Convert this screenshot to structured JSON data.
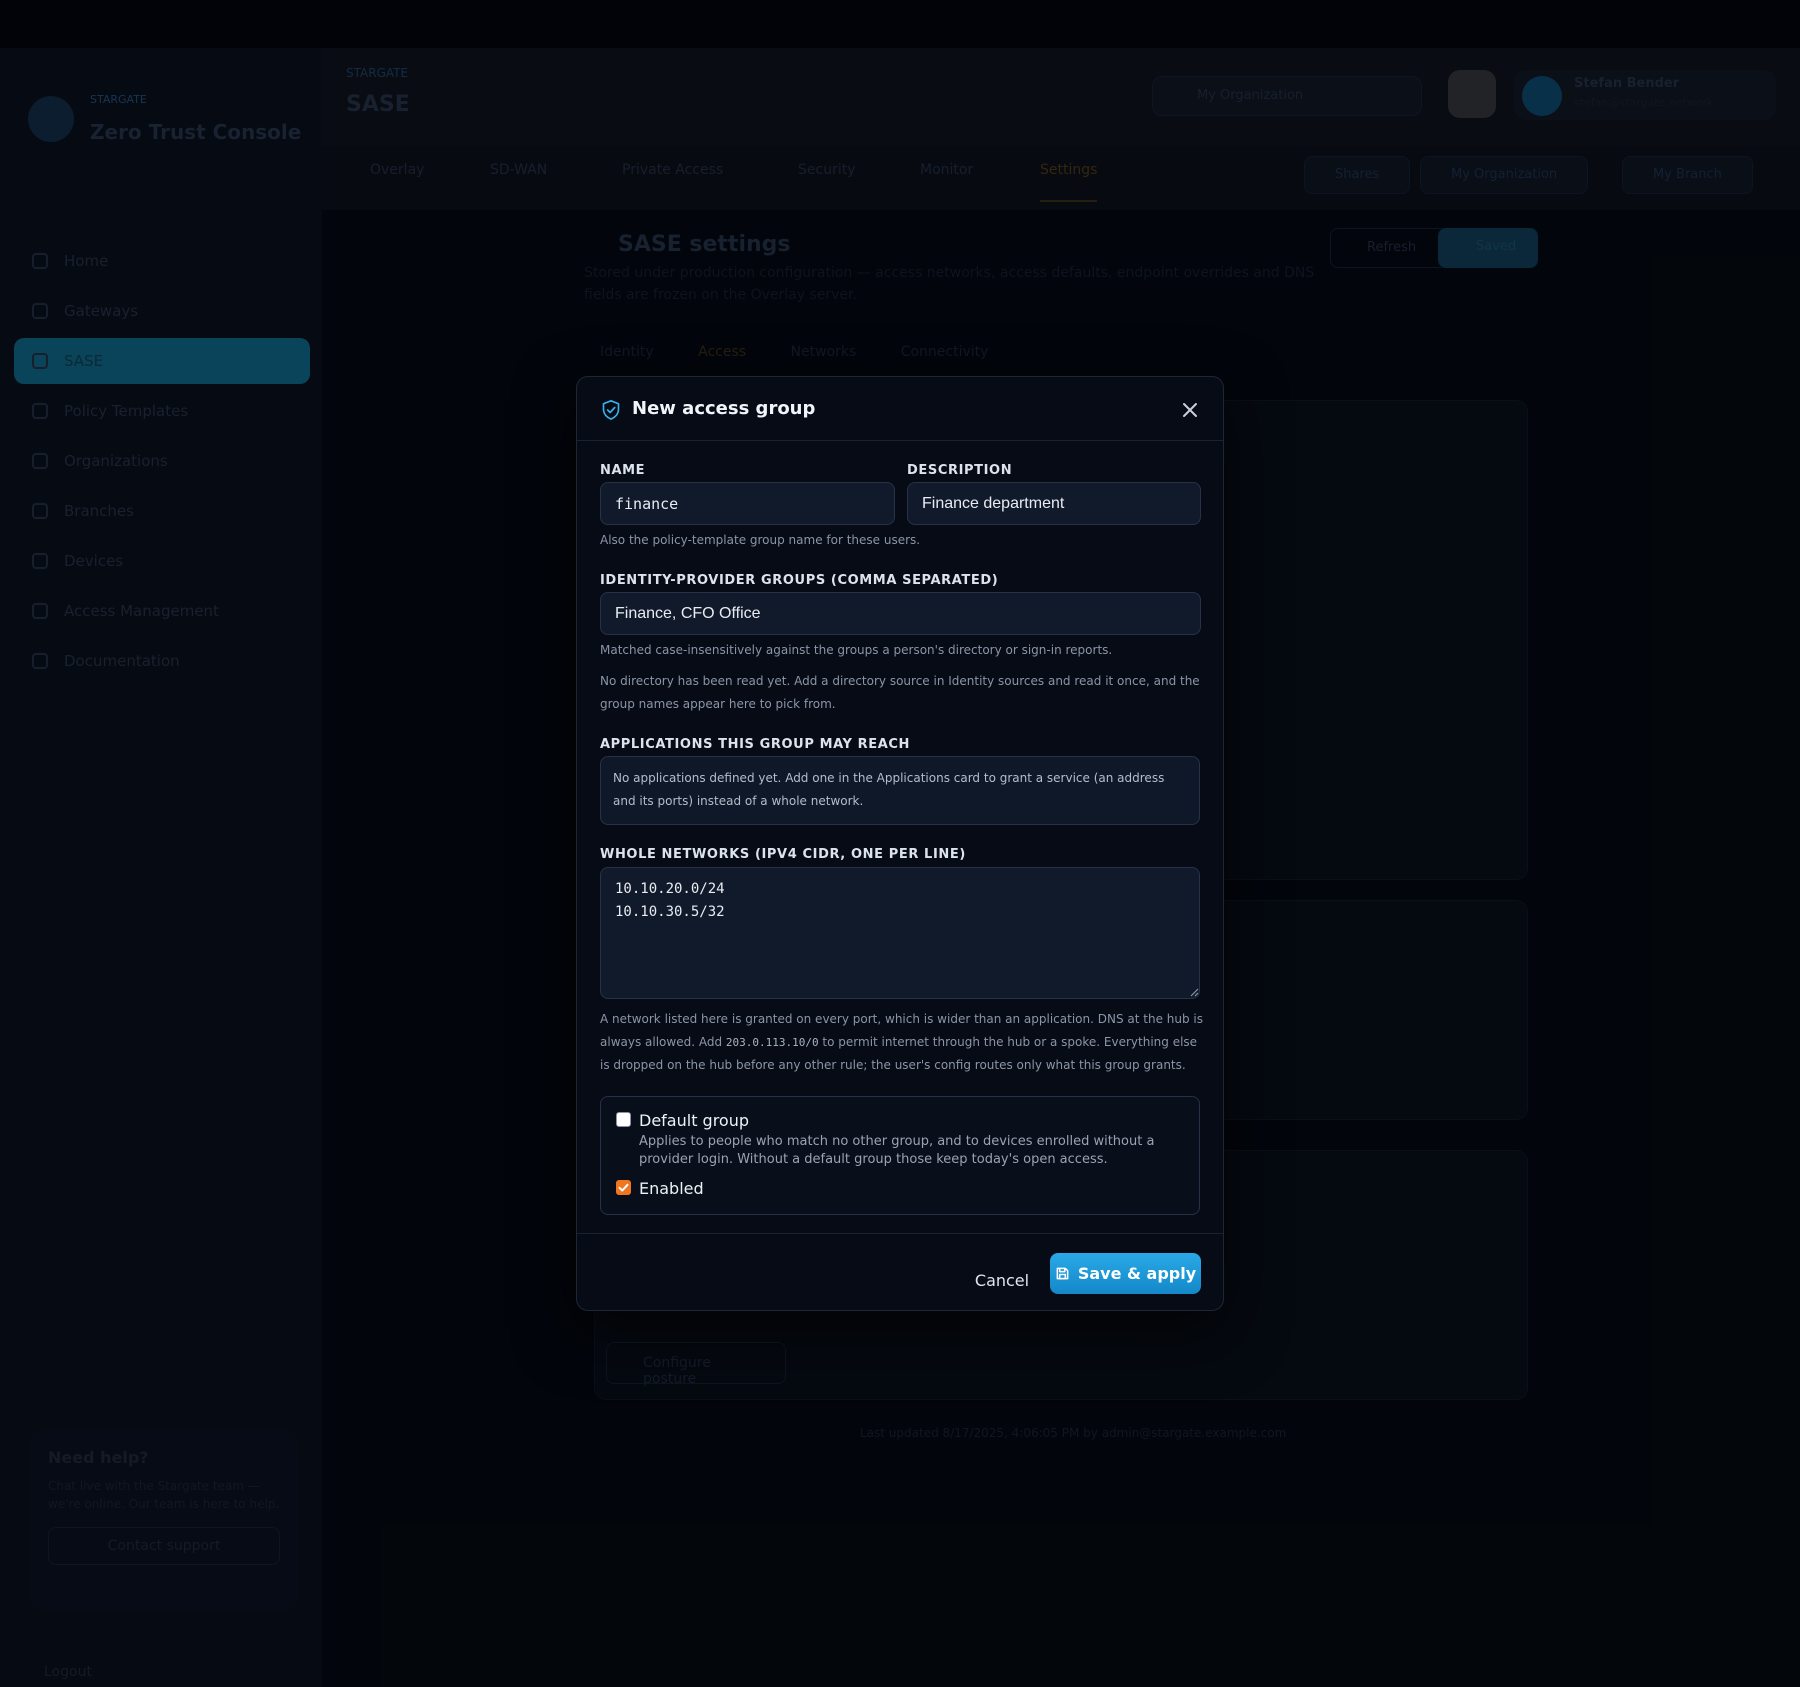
{
  "background": {
    "brand": {
      "kicker": "STARGATE",
      "name": "Zero Trust Console"
    },
    "nav": [
      "Home",
      "Gateways",
      "SASE",
      "Policy Templates",
      "Organizations",
      "Branches",
      "Devices",
      "Access Management",
      "Documentation"
    ],
    "help": {
      "title": "Need help?",
      "text": "Chat live with the Stargate team — we're online. Our team is here to help.",
      "button": "Contact support"
    },
    "logout": "Logout",
    "header": {
      "crumb": "STARGATE",
      "title": "SASE",
      "org": "My Organization",
      "user_name": "Stefan Bender",
      "user_email": "stefan@stargate.network"
    },
    "tabs": [
      "Overlay",
      "SD-WAN",
      "Private Access",
      "Security",
      "Monitor",
      "Settings"
    ],
    "right_pills": [
      "Shares",
      "My Organization",
      "My Branch"
    ],
    "content": {
      "title": "SASE settings",
      "subtitle": "Stored under production configuration — access networks, access defaults, endpoint overrides and DNS fields are frozen on the Overlay server.",
      "refresh": "Refresh",
      "save_all": "Saved",
      "subtabs": [
        "Identity",
        "Access",
        "Networks",
        "Connectivity"
      ],
      "configure_button": "Configure posture",
      "footnote": "Last updated 8/17/2025, 4:06:05 PM by admin@stargate.example.com"
    }
  },
  "modal": {
    "title": "New access group",
    "name": {
      "label": "NAME",
      "value": "finance",
      "help": "Also the policy-template group name for these users."
    },
    "description": {
      "label": "DESCRIPTION",
      "value": "Finance department"
    },
    "idp": {
      "label": "IDENTITY-PROVIDER GROUPS (COMMA SEPARATED)",
      "value": "Finance, CFO Office",
      "help1": "Matched case-insensitively against the groups a person's directory or sign-in reports.",
      "help2": "No directory has been read yet. Add a directory source in Identity sources and read it once, and the group names appear here to pick from."
    },
    "apps": {
      "label": "APPLICATIONS THIS GROUP MAY REACH",
      "empty": "No applications defined yet. Add one in the Applications card to grant a service (an address and its ports) instead of a whole network."
    },
    "networks": {
      "label": "WHOLE NETWORKS (IPV4 CIDR, ONE PER LINE)",
      "value": "10.10.20.0/24\n10.10.30.5/32",
      "help_pre": "A network listed here is granted on every port, which is wider than an application. DNS at the hub is always allowed. Add ",
      "help_code": "203.0.113.10/0",
      "help_post": " to permit internet through the hub or a spoke. Everything else is dropped on the hub before any other rule; the user's config routes only what this group grants."
    },
    "default_group": {
      "label": "Default group",
      "checked": false,
      "desc": "Applies to people who match no other group, and to devices enrolled without a provider login. Without a default group those keep today's open access."
    },
    "enabled": {
      "label": "Enabled",
      "checked": true
    },
    "cancel": "Cancel",
    "save": "Save & apply"
  },
  "colors": {
    "accent": "#2aa9e6",
    "checkbox_on": "#f0771f",
    "modal_bg": "#060b16"
  }
}
